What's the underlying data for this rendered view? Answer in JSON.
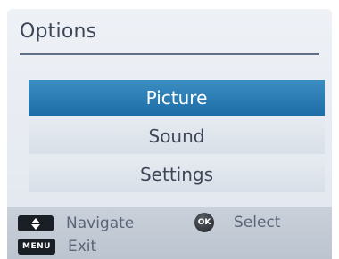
{
  "dialog": {
    "title": "Options"
  },
  "menu": {
    "items": [
      {
        "label": "Picture",
        "selected": true
      },
      {
        "label": "Sound",
        "selected": false
      },
      {
        "label": "Settings",
        "selected": false
      }
    ]
  },
  "footer": {
    "navigate_label": "Navigate",
    "select_label": "Select",
    "exit_label": "Exit",
    "ok_key_label": "OK",
    "menu_key_label": "MENU"
  },
  "colors": {
    "selected_bg": "#2a7fb8",
    "panel_bg": "#e6eaf0",
    "footer_bg": "#c4cbd6",
    "text": "#3e4656"
  }
}
